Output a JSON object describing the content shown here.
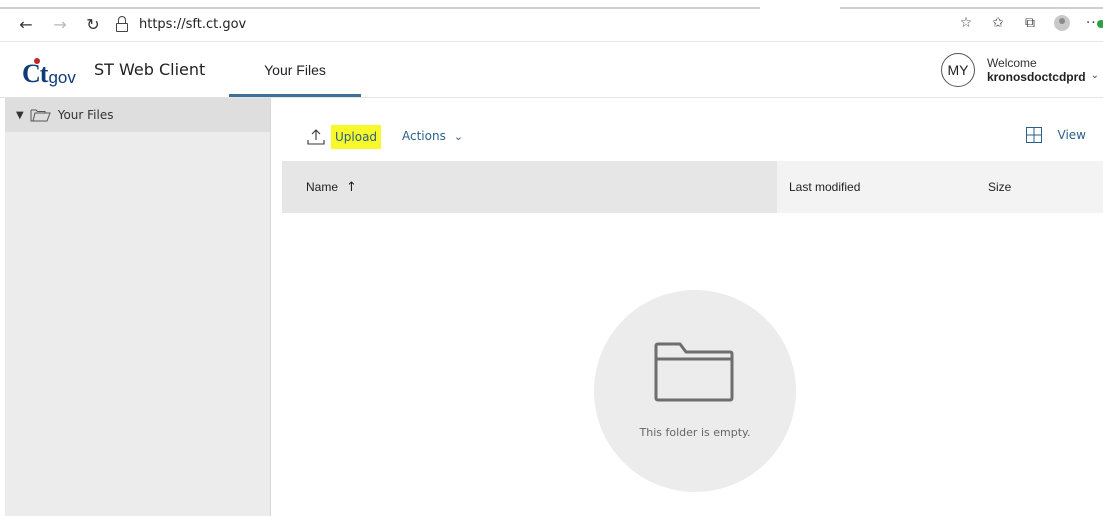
{
  "browser": {
    "back_icon": "←",
    "forward_icon": "→",
    "refresh_icon": "↻",
    "url": "https://sft.ct.gov",
    "favorite_icon": "☆",
    "favorites_bar_icon": "✩",
    "collections_icon": "⧉",
    "more_icon": "···"
  },
  "header": {
    "logo_ct": "Ct",
    "logo_gov": "gov",
    "app_title": "ST Web Client",
    "tab_label": "Your Files",
    "avatar_initials": "MY",
    "welcome_label": "Welcome",
    "username": "kronosdoctcdprd",
    "user_caret": "⌄"
  },
  "sidebar": {
    "items": [
      {
        "label": "Your Files",
        "expanded": true,
        "caret": "▼"
      }
    ]
  },
  "toolbar": {
    "upload_label": "Upload",
    "actions_label": "Actions",
    "actions_caret": "⌄",
    "view_label": "View"
  },
  "table": {
    "columns": [
      {
        "label": "Name",
        "sort_icon": "↑"
      },
      {
        "label": "Last modified"
      },
      {
        "label": "Size"
      }
    ],
    "rows": []
  },
  "empty_state": {
    "message": "This folder is empty."
  },
  "colors": {
    "accent_underline": "#3f7198",
    "link_blue": "#2b5f8b",
    "highlight_yellow": "#f8f82a",
    "logo_blue": "#0f3c78",
    "logo_red": "#c0262d",
    "sidebar_bg": "#ececec"
  }
}
